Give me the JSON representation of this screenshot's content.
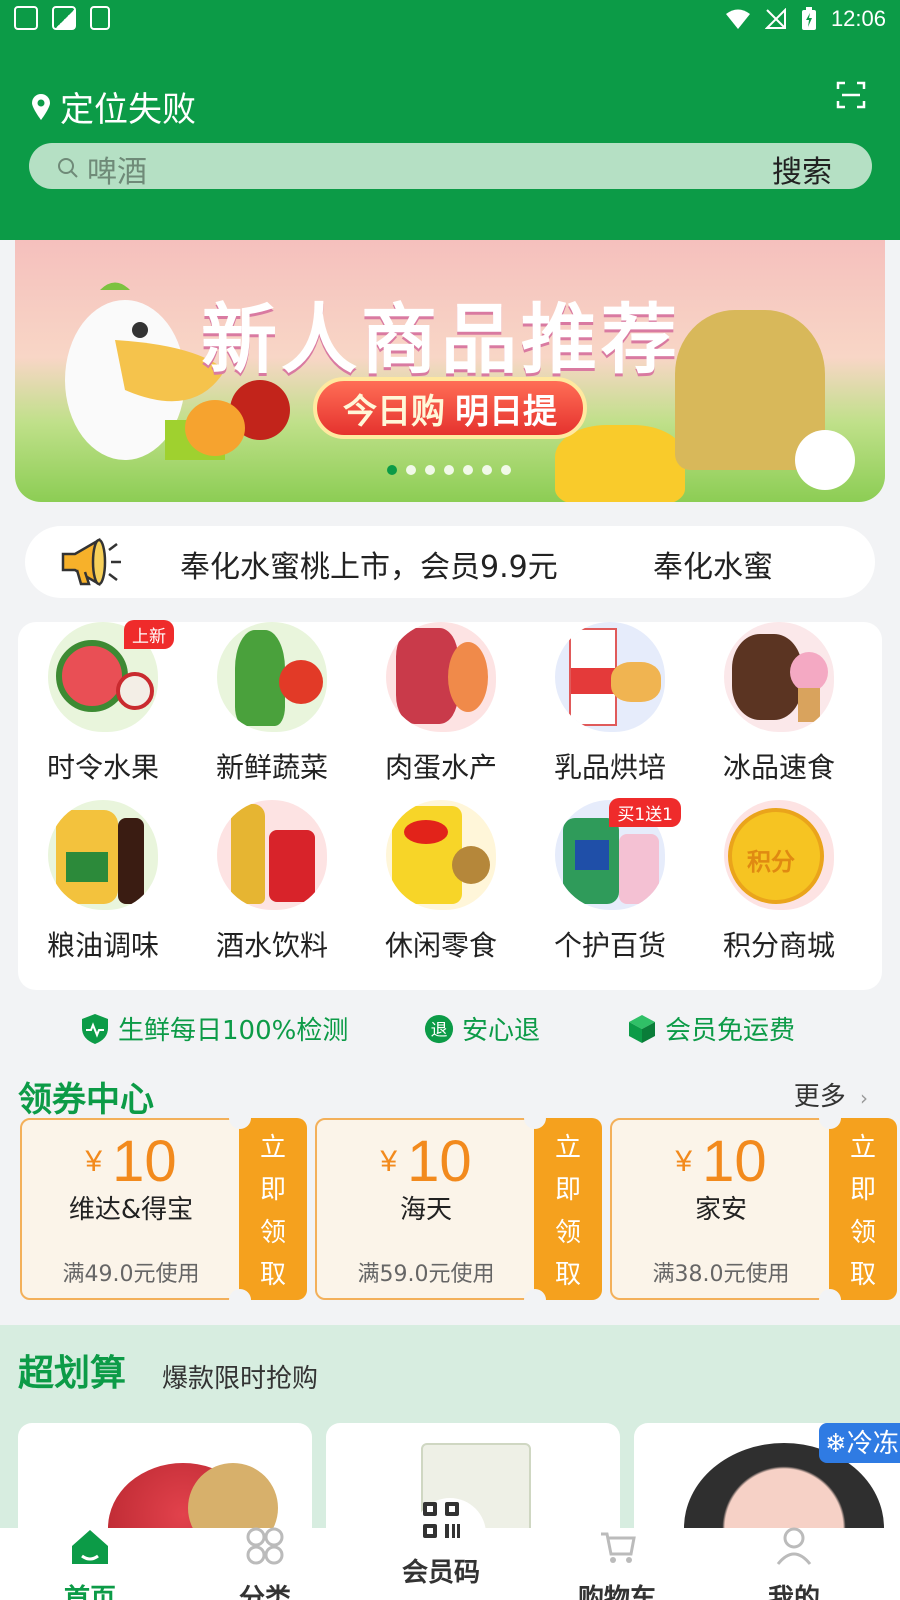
{
  "status_bar": {
    "time": "12:06"
  },
  "header": {
    "location": "定位失败",
    "search_placeholder": "啤酒",
    "search_button": "搜索"
  },
  "banner": {
    "title": "新人商品推荐",
    "pill_left": "今日购",
    "pill_right": "明日提",
    "dot_count": 7,
    "active_dot": 0
  },
  "notice": {
    "text": "奉化水蜜桃上市，会员9.9元",
    "text_repeat": "奉化水蜜"
  },
  "categories": [
    {
      "label": "时令水果",
      "badge": "上新"
    },
    {
      "label": "新鲜蔬菜"
    },
    {
      "label": "肉蛋水产"
    },
    {
      "label": "乳品烘培"
    },
    {
      "label": "冰品速食"
    },
    {
      "label": "粮油调味"
    },
    {
      "label": "酒水饮料"
    },
    {
      "label": "休闲零食"
    },
    {
      "label": "个护百货",
      "badge": "买1送1"
    },
    {
      "label": "积分商城"
    }
  ],
  "assurances": [
    {
      "label": "生鲜每日100%检测",
      "icon": "shield-icon"
    },
    {
      "label": "安心退",
      "icon": "refund-icon"
    },
    {
      "label": "会员免运费",
      "icon": "box-icon"
    }
  ],
  "coupon_section": {
    "title": "领券中心",
    "more": "更多",
    "coupons": [
      {
        "currency": "¥",
        "amount": "10",
        "name": "维达&得宝",
        "condition": "满49.0元使用",
        "action": "立即领取"
      },
      {
        "currency": "¥",
        "amount": "10",
        "name": "海天",
        "condition": "满59.0元使用",
        "action": "立即领取"
      },
      {
        "currency": "¥",
        "amount": "10",
        "name": "家安",
        "condition": "满38.0元使用",
        "action": "立即领取"
      }
    ]
  },
  "deals": {
    "title": "超划算",
    "subtitle": "爆款限时抢购",
    "cold_tag": "冷冻"
  },
  "nav": {
    "items": [
      {
        "label": "首页",
        "icon": "home-icon",
        "active": true
      },
      {
        "label": "分类",
        "icon": "category-icon"
      },
      {
        "label": "会员码",
        "icon": "qrcode-icon"
      },
      {
        "label": "购物车",
        "icon": "cart-icon"
      },
      {
        "label": "我的",
        "icon": "user-icon"
      }
    ]
  },
  "colors": {
    "brand": "#0c9b47",
    "coupon_accent": "#f5a11e",
    "badge_red": "#ef2b2b"
  }
}
